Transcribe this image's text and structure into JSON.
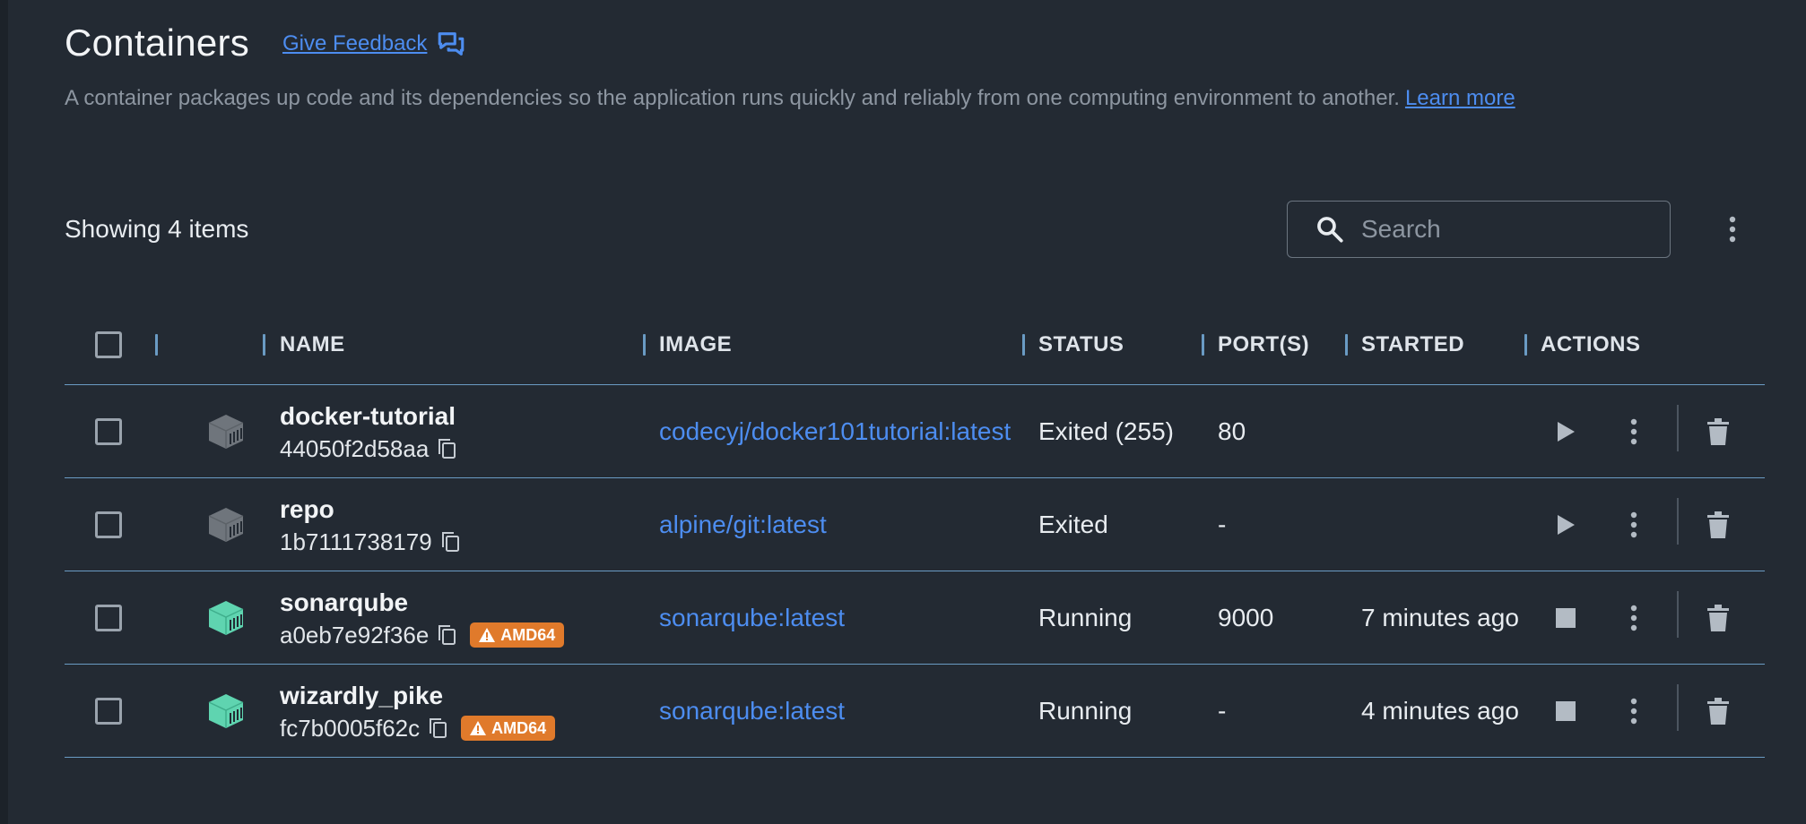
{
  "header": {
    "title": "Containers",
    "feedback_label": "Give Feedback",
    "description": "A container packages up code and its dependencies so the application runs quickly and reliably from one computing environment to another.",
    "learn_more": "Learn more"
  },
  "toolbar": {
    "item_count": "Showing 4 items",
    "search_placeholder": "Search"
  },
  "table": {
    "columns": {
      "name": "NAME",
      "image": "IMAGE",
      "status": "STATUS",
      "ports": "PORT(S)",
      "started": "STARTED",
      "actions": "ACTIONS"
    },
    "rows": [
      {
        "name": "docker-tutorial",
        "id": "44050f2d58aa",
        "badge": "",
        "image": "codecyj/docker101tutorial:latest",
        "status": "Exited (255)",
        "ports": "80",
        "started": "",
        "running": false
      },
      {
        "name": "repo",
        "id": "1b7111738179",
        "badge": "",
        "image": "alpine/git:latest",
        "status": "Exited",
        "ports": "-",
        "started": "",
        "running": false
      },
      {
        "name": "sonarqube",
        "id": "a0eb7e92f36e",
        "badge": "AMD64",
        "image": "sonarqube:latest",
        "status": "Running",
        "ports": "9000",
        "started": "7 minutes ago",
        "running": true
      },
      {
        "name": "wizardly_pike",
        "id": "fc7b0005f62c",
        "badge": "AMD64",
        "image": "sonarqube:latest",
        "status": "Running",
        "ports": "-",
        "started": "4 minutes ago",
        "running": true
      }
    ]
  },
  "colors": {
    "background": "#232a33",
    "link": "#4d8df0",
    "running_icon": "#5fd4b0",
    "stopped_icon": "#6f757c",
    "badge": "#e07a2b",
    "divider": "#6a9bc4"
  },
  "icons": {
    "feedback": "chat-bubbles-icon",
    "search": "search-icon",
    "more": "kebab-icon",
    "copy": "copy-icon",
    "start": "play-icon",
    "stop": "stop-icon",
    "delete": "trash-icon",
    "warning": "warning-icon",
    "container": "container-cube-icon"
  }
}
